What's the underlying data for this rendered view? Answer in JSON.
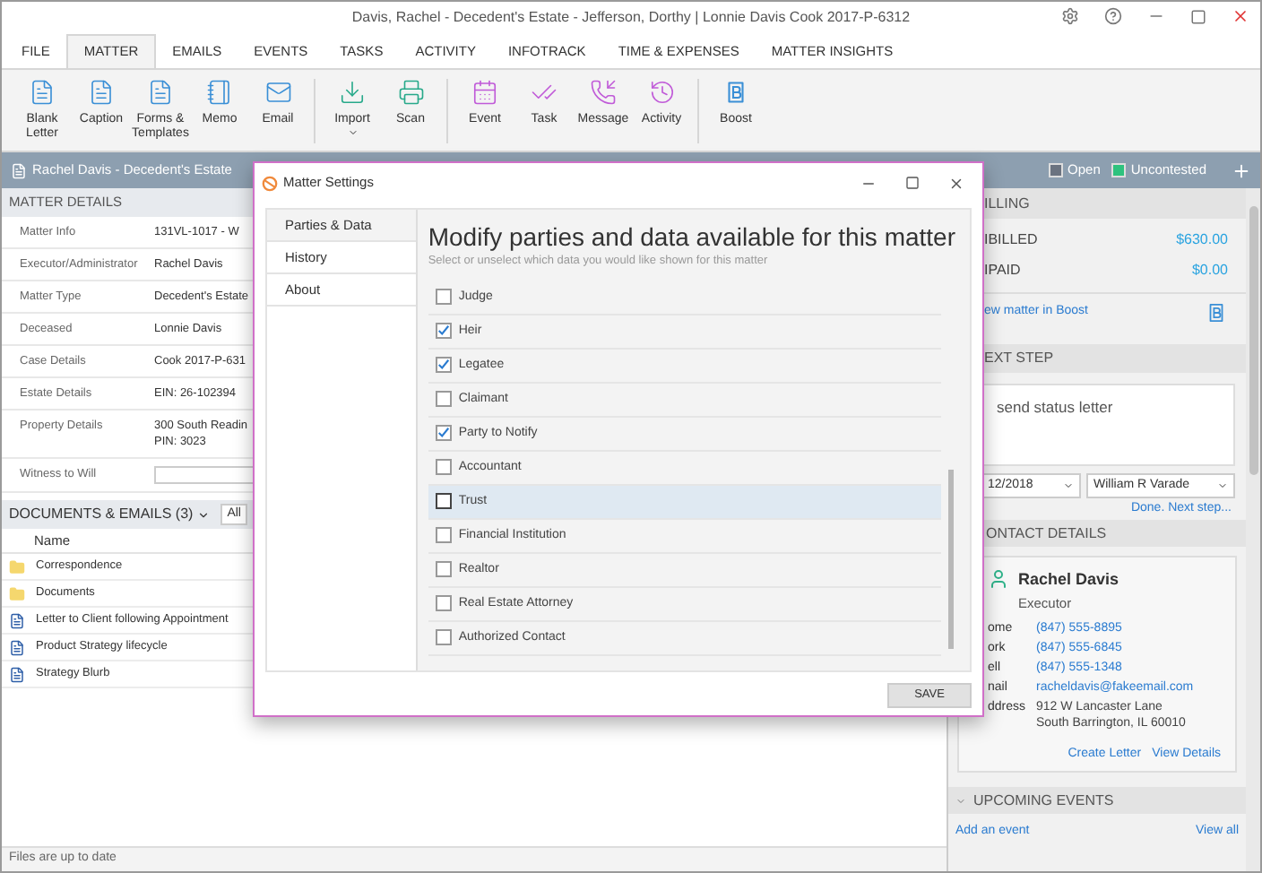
{
  "window": {
    "title": "Davis, Rachel - Decedent's Estate - Jefferson, Dorthy | Lonnie Davis Cook 2017-P-6312"
  },
  "tabs": [
    {
      "label": "FILE",
      "selected": false
    },
    {
      "label": "MATTER",
      "selected": true
    },
    {
      "label": "EMAILS",
      "selected": false
    },
    {
      "label": "EVENTS",
      "selected": false
    },
    {
      "label": "TASKS",
      "selected": false
    },
    {
      "label": "ACTIVITY",
      "selected": false
    },
    {
      "label": "INFOTRACK",
      "selected": false
    },
    {
      "label": "TIME & EXPENSES",
      "selected": false
    },
    {
      "label": "MATTER INSIGHTS",
      "selected": false
    }
  ],
  "ribbon": [
    {
      "kind": "letter",
      "label": "Blank Letter",
      "dropdown": false,
      "separator_after": false
    },
    {
      "kind": "caption",
      "label": "Caption",
      "dropdown": false,
      "separator_after": false
    },
    {
      "kind": "forms",
      "label": "Forms & Templates",
      "dropdown": false,
      "separator_after": false
    },
    {
      "kind": "memo",
      "label": "Memo",
      "dropdown": false,
      "separator_after": false
    },
    {
      "kind": "email",
      "label": "Email",
      "dropdown": false,
      "separator_after": true
    },
    {
      "kind": "import",
      "label": "Import",
      "dropdown": true,
      "separator_after": false
    },
    {
      "kind": "scan",
      "label": "Scan",
      "dropdown": false,
      "separator_after": true
    },
    {
      "kind": "event",
      "label": "Event",
      "dropdown": false,
      "separator_after": false
    },
    {
      "kind": "task",
      "label": "Task",
      "dropdown": false,
      "separator_after": false
    },
    {
      "kind": "message",
      "label": "Message",
      "dropdown": false,
      "separator_after": false
    },
    {
      "kind": "activity",
      "label": "Activity",
      "dropdown": false,
      "separator_after": true
    },
    {
      "kind": "boost",
      "label": "Boost",
      "dropdown": false,
      "separator_after": false
    }
  ],
  "matter_header": {
    "title": "Rachel Davis - Decedent's Estate",
    "statuses": [
      {
        "label": "Open",
        "color": "#6b7380"
      },
      {
        "label": "Uncontested",
        "color": "#2ec27e"
      }
    ]
  },
  "matter_details": {
    "title": "MATTER DETAILS",
    "rows": [
      {
        "kind": "text",
        "label": "Matter Info",
        "lines": [
          "131VL-1017 - W"
        ]
      },
      {
        "kind": "text",
        "label": "Executor/Administrator",
        "lines": [
          "Rachel Davis"
        ]
      },
      {
        "kind": "text",
        "label": "Matter Type",
        "lines": [
          "Decedent's Estate"
        ]
      },
      {
        "kind": "text",
        "label": "Deceased",
        "lines": [
          "Lonnie Davis"
        ]
      },
      {
        "kind": "text",
        "label": "Case Details",
        "lines": [
          "Cook 2017-P-631"
        ]
      },
      {
        "kind": "text",
        "label": "Estate Details",
        "lines": [
          "EIN: 26-102394"
        ]
      },
      {
        "kind": "text",
        "label": "Property Details",
        "lines": [
          "300 South Readin",
          "PIN: 3023"
        ]
      },
      {
        "kind": "field",
        "label": "Witness to Will",
        "lines": []
      }
    ]
  },
  "documents": {
    "title": "DOCUMENTS & EMAILS (3)",
    "filter": "All",
    "column": "Name",
    "rows": [
      {
        "kind": "folder",
        "name": "Correspondence"
      },
      {
        "kind": "folder",
        "name": "Documents"
      },
      {
        "kind": "document",
        "name": "Letter to Client following Appointment"
      },
      {
        "kind": "document",
        "name": "Product Strategy lifecycle"
      },
      {
        "kind": "document",
        "name": "Strategy Blurb"
      }
    ]
  },
  "status_bar": "Files are up to date",
  "dialog": {
    "title": "Matter Settings",
    "nav": [
      {
        "label": "Parties & Data",
        "selected": true
      },
      {
        "label": "History",
        "selected": false
      },
      {
        "label": "About",
        "selected": false
      }
    ],
    "heading": "Modify parties and data available for this matter",
    "subheading": "Select or unselect which data you would like shown for this matter",
    "options": [
      {
        "label": "Judge",
        "checked": false,
        "selected": false
      },
      {
        "label": "Heir",
        "checked": true,
        "selected": false
      },
      {
        "label": "Legatee",
        "checked": true,
        "selected": false
      },
      {
        "label": "Claimant",
        "checked": false,
        "selected": false
      },
      {
        "label": "Party to Notify",
        "checked": true,
        "selected": false
      },
      {
        "label": "Accountant",
        "checked": false,
        "selected": false
      },
      {
        "label": "Trust",
        "checked": false,
        "selected": true
      },
      {
        "label": "Financial Institution",
        "checked": false,
        "selected": false
      },
      {
        "label": "Realtor",
        "checked": false,
        "selected": false
      },
      {
        "label": "Real Estate Attorney",
        "checked": false,
        "selected": false
      },
      {
        "label": "Authorized Contact",
        "checked": false,
        "selected": false
      }
    ],
    "save": "SAVE"
  },
  "billing": {
    "title": "ILLING",
    "rows": [
      {
        "label": "IBILLED",
        "value": "$630.00"
      },
      {
        "label": "IPAID",
        "value": "$0.00"
      }
    ],
    "link": "ew matter in Boost"
  },
  "next_step": {
    "title": "EXT STEP",
    "text": "send status letter",
    "date": "12/2018",
    "assignee": "William R Varade",
    "link": "Done. Next step..."
  },
  "contact": {
    "title": "ONTACT DETAILS",
    "name": "Rachel Davis",
    "role": "Executor",
    "rows": [
      {
        "label": "ome",
        "kind": "link",
        "lines": [
          "(847) 555-8895"
        ]
      },
      {
        "label": "ork",
        "kind": "link",
        "lines": [
          "(847) 555-6845"
        ]
      },
      {
        "label": "ell",
        "kind": "link",
        "lines": [
          "(847) 555-1348"
        ]
      },
      {
        "label": "nail",
        "kind": "link",
        "lines": [
          "racheldavis@fakeemail.com"
        ]
      },
      {
        "label": "ddress",
        "kind": "text",
        "lines": [
          "912 W Lancaster Lane",
          "South Barrington, IL 60010"
        ]
      }
    ],
    "actions": [
      "Create Letter",
      "View Details"
    ]
  },
  "upcoming": {
    "title": "UPCOMING EVENTS",
    "add": "Add an event",
    "view": "View all"
  }
}
